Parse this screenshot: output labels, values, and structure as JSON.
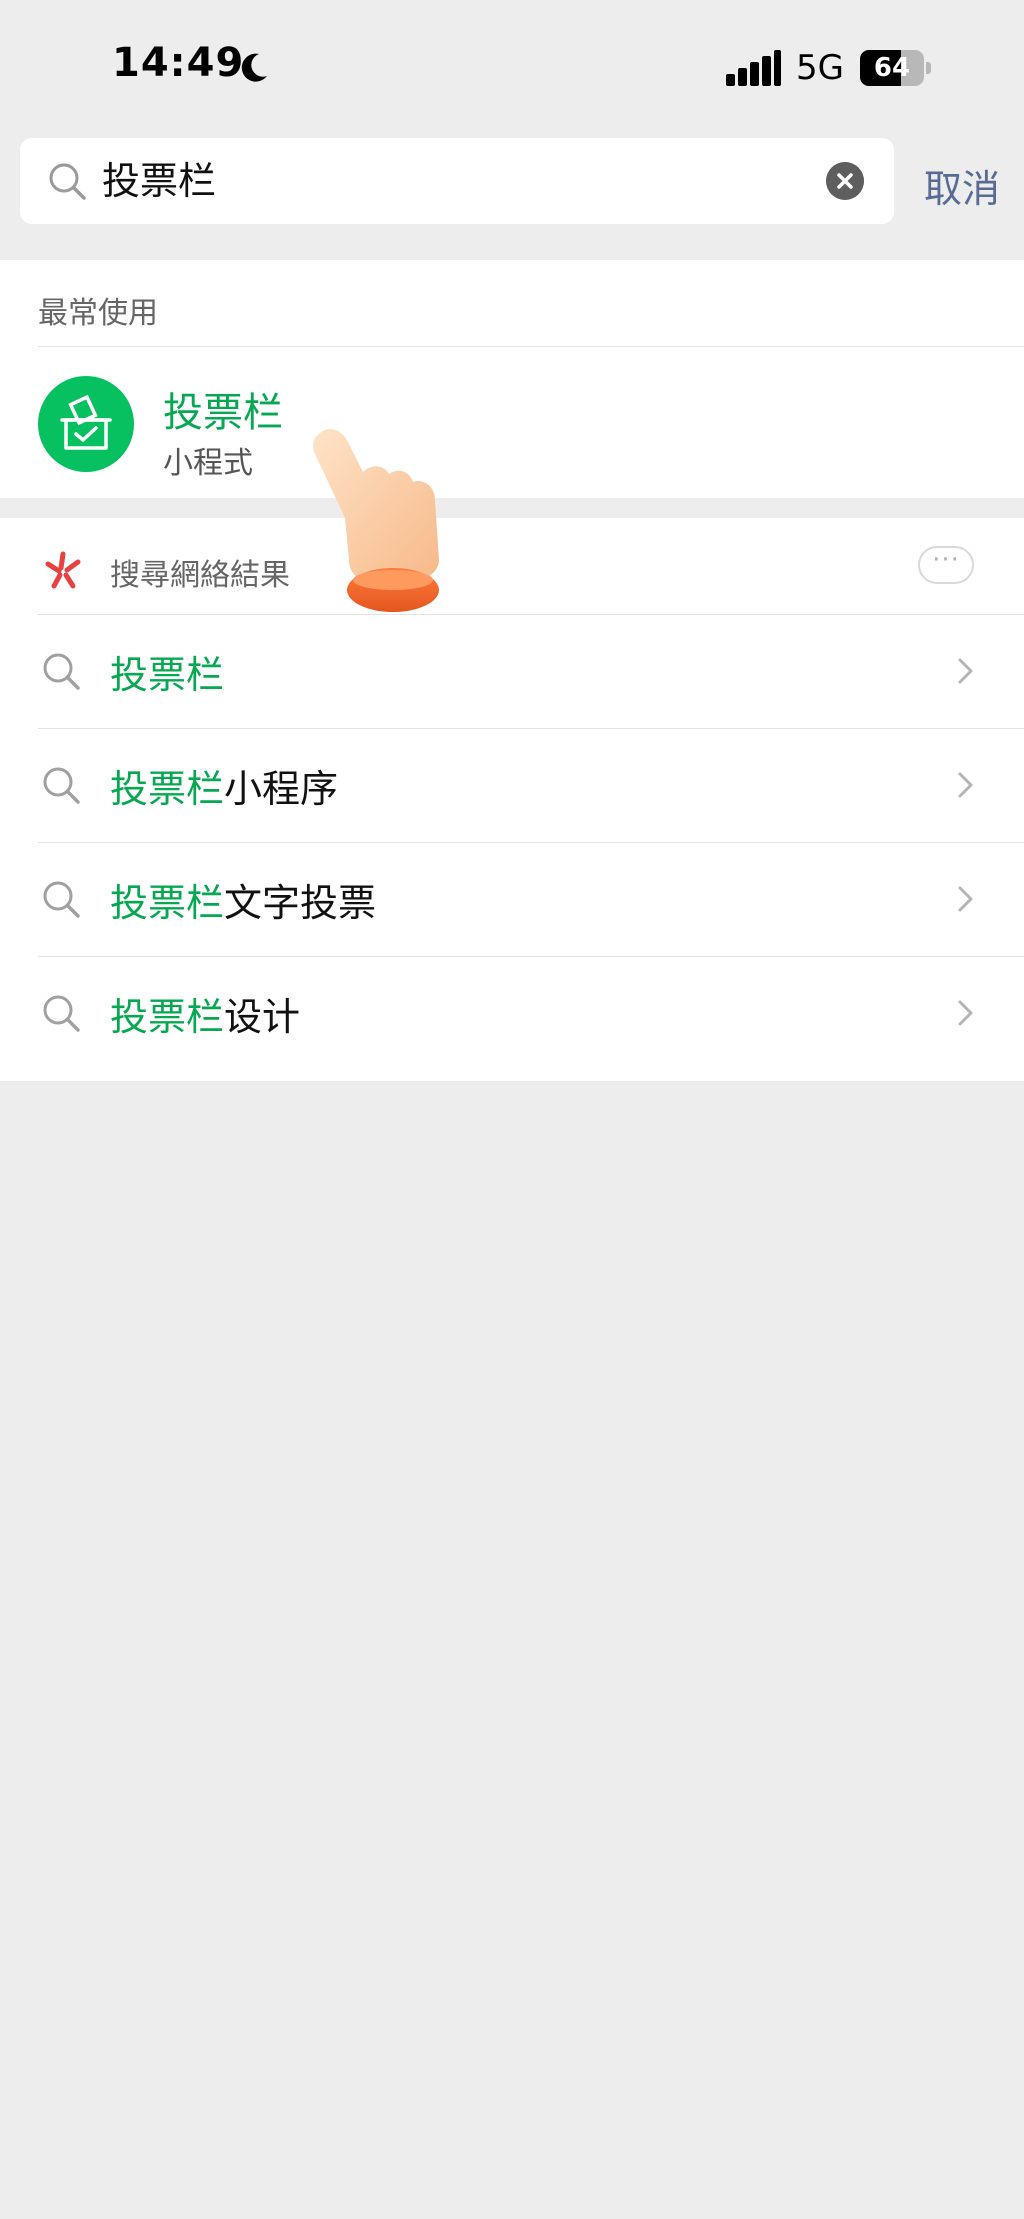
{
  "status_bar": {
    "time": "14:49",
    "network": "5G",
    "battery_level": 64,
    "battery_text": "64",
    "icons": [
      "moon-icon",
      "signal-icon",
      "battery-icon"
    ]
  },
  "search": {
    "value": "投票栏",
    "cancel_label": "取消",
    "icons": [
      "search-icon",
      "clear-icon"
    ]
  },
  "recent": {
    "header": "最常使用",
    "app_name": "投票栏",
    "app_type": "小程式",
    "icon": "ballot-box-icon",
    "accent_color": "#07c160"
  },
  "web": {
    "header": "搜尋網絡結果",
    "more_label": "···",
    "icon": "web-search-logo-icon",
    "suggestions": [
      {
        "highlight": "投票栏",
        "rest": ""
      },
      {
        "highlight": "投票栏",
        "rest": "小程序"
      },
      {
        "highlight": "投票栏",
        "rest": "文字投票"
      },
      {
        "highlight": "投票栏",
        "rest": "设计"
      }
    ]
  },
  "overlay": {
    "icon": "pointing-hand-icon"
  },
  "colors": {
    "highlight": "#07a852",
    "link": "#576b95",
    "background": "#ededed"
  }
}
